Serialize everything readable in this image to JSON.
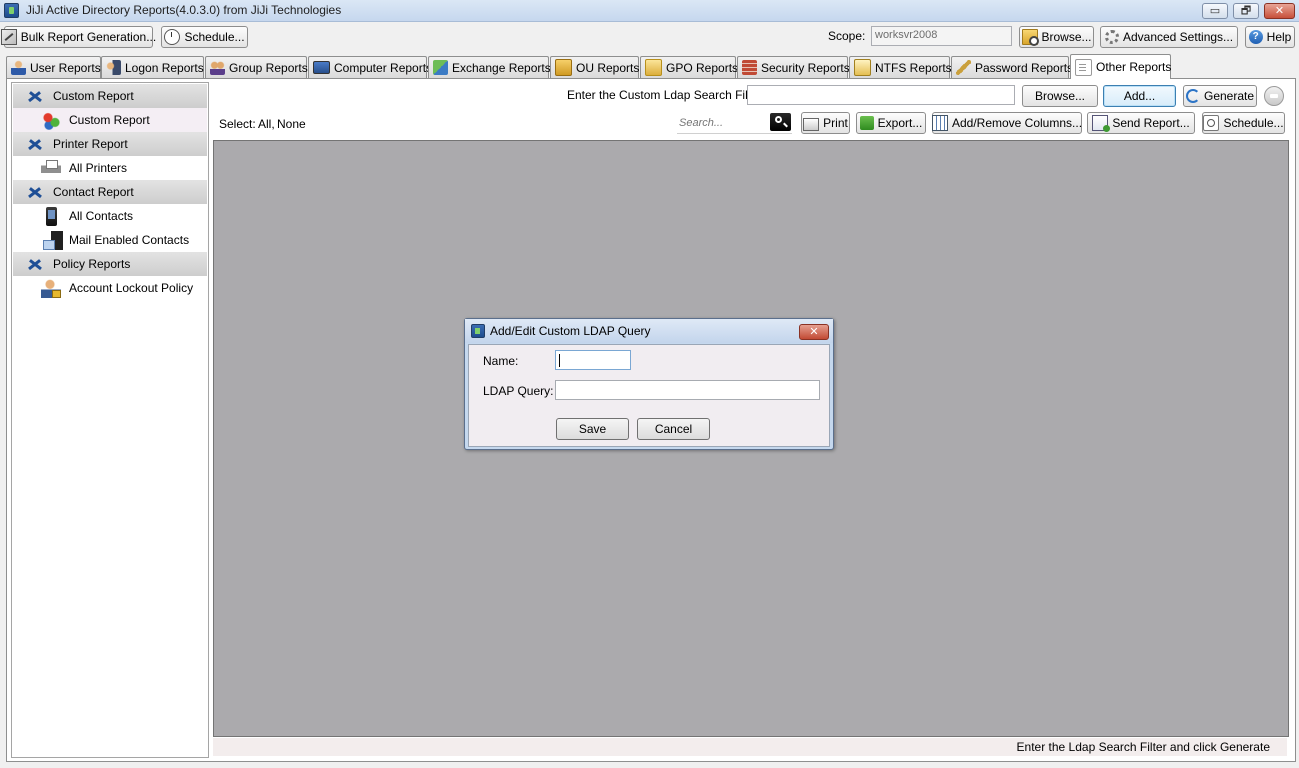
{
  "window": {
    "title": "JiJi Active Directory Reports(4.0.3.0) from JiJi Technologies",
    "minimize": "▭",
    "maximize": "🗗",
    "close": "✕"
  },
  "toolbar": {
    "bulk_label": "Bulk Report Generation...",
    "schedule_label": "Schedule...",
    "scope_label": "Scope:",
    "scope_value": "worksvr2008",
    "browse_label": "Browse...",
    "advanced_label": "Advanced  Settings...",
    "help_label": "Help"
  },
  "tabs": [
    {
      "label": "User Reports"
    },
    {
      "label": "Logon Reports"
    },
    {
      "label": "Group Reports"
    },
    {
      "label": "Computer Reports"
    },
    {
      "label": "Exchange Reports"
    },
    {
      "label": "OU Reports"
    },
    {
      "label": "GPO Reports"
    },
    {
      "label": "Security Reports"
    },
    {
      "label": "NTFS Reports"
    },
    {
      "label": "Password Reports"
    },
    {
      "label": "Other Reports"
    }
  ],
  "sidebar": {
    "sections": [
      {
        "title": "Custom Report",
        "items": [
          "Custom Report"
        ]
      },
      {
        "title": "Printer Report",
        "items": [
          "All Printers"
        ]
      },
      {
        "title": "Contact Report",
        "items": [
          "All Contacts",
          "Mail Enabled Contacts"
        ]
      },
      {
        "title": "Policy Reports",
        "items": [
          "Account Lockout Policy"
        ]
      }
    ]
  },
  "filterbar": {
    "filter_label": "Enter the Custom Ldap Search Filter:",
    "filter_value": "",
    "browse_label": "Browse...",
    "add_label": "Add...",
    "generate_label": "Generate"
  },
  "actionbar": {
    "select_label": "Select:",
    "select_all": "All,",
    "select_none": "None",
    "search_placeholder": "Search...",
    "print_label": "Print",
    "export_label": "Export...",
    "columns_label": "Add/Remove Columns...",
    "send_label": "Send Report...",
    "schedule_label": "Schedule..."
  },
  "status": {
    "message": "Enter the Ldap Search Filter and click Generate"
  },
  "dialog": {
    "title": "Add/Edit Custom LDAP Query",
    "close": "✕",
    "name_label": "Name:",
    "name_value": "",
    "query_label": "LDAP Query:",
    "query_value": "",
    "save_label": "Save",
    "cancel_label": "Cancel"
  }
}
